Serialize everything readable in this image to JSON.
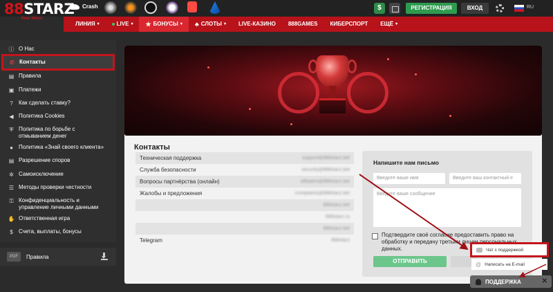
{
  "header": {
    "logo_text_prefix": "8",
    "logo_text_mid": "8",
    "logo_text_suffix": "STARZ",
    "logo_tagline": "Your Wins!",
    "crash_label": "Crash",
    "register_label": "РЕГИСТРАЦИЯ",
    "login_label": "ВХОД",
    "dollar_symbol": "$",
    "lang": "RU"
  },
  "nav": {
    "items": [
      {
        "label": "ЛИНИЯ"
      },
      {
        "label": "LIVE"
      },
      {
        "label": "БОНУСЫ"
      },
      {
        "label": "СЛОТЫ"
      },
      {
        "label": "LIVE-КАЗИНО"
      },
      {
        "label": "888GAMES"
      },
      {
        "label": "КИБЕРСПОРТ"
      },
      {
        "label": "ЕЩЁ"
      }
    ]
  },
  "sidebar": {
    "items": [
      {
        "label": "О Нас",
        "icon": "info-icon"
      },
      {
        "label": "Контакты",
        "icon": "phone-icon"
      },
      {
        "label": "Правила",
        "icon": "document-icon"
      },
      {
        "label": "Платежи",
        "icon": "payments-icon"
      },
      {
        "label": "Как сделать ставку?",
        "icon": "question-icon"
      },
      {
        "label": "Политика Cookies",
        "icon": "megaphone-icon"
      },
      {
        "label": "Политика по борьбе с отмыванием денег",
        "icon": "shield-icon"
      },
      {
        "label": "Политика «Знай своего клиента»",
        "icon": "person-icon"
      },
      {
        "label": "Разрешение споров",
        "icon": "document-icon"
      },
      {
        "label": "Самоисключение",
        "icon": "gear-icon"
      },
      {
        "label": "Методы проверки честности",
        "icon": "list-icon"
      },
      {
        "label": "Конфиденциальность и управление личными данными",
        "icon": "lock-icon"
      },
      {
        "label": "Ответственная игра",
        "icon": "hand-icon"
      },
      {
        "label": "Счета, выплаты, бонусы",
        "icon": "dollar-icon"
      }
    ],
    "pdf_badge": "PDF",
    "pdf_label": "Правила"
  },
  "main": {
    "section_title": "Контакты",
    "contacts": [
      {
        "label": "Техническая поддержка",
        "value": "support@888starz.bet"
      },
      {
        "label": "Служба безопасности",
        "value": "security@888starz.bet"
      },
      {
        "label": "Вопросы партнёрства (онлайн)",
        "value": "affiliates@888starz.bet"
      },
      {
        "label": "Жалобы и предложения",
        "value": "complaints@888starz.bet"
      },
      {
        "label": "",
        "value": "888starz.bet"
      },
      {
        "label": "",
        "value": "888starz.ru"
      },
      {
        "label": "",
        "value": "888starz.bet"
      },
      {
        "label": "Telegram",
        "value": "888starz"
      }
    ]
  },
  "form": {
    "title": "Напишите нам письмо",
    "name_placeholder": "Введите ваше имя",
    "contact_placeholder": "Введите ваш контактный е",
    "message_placeholder": "Введите ваше сообщение",
    "agree_text": "Подтвердите своё согласие предоставить право на обработку и передачу третьим лицам персональных данных.",
    "send_label": "ОТПРАВИТЬ"
  },
  "support": {
    "chat_label": "Чат с поддержкой",
    "mail_label": "Написать на E-mail",
    "button_label": "ПОДДЕРЖКА",
    "close_symbol": "✕"
  },
  "colors": {
    "brand_red": "#b8121a",
    "green": "#2e9b4f",
    "annotation_red": "#c4141c"
  }
}
